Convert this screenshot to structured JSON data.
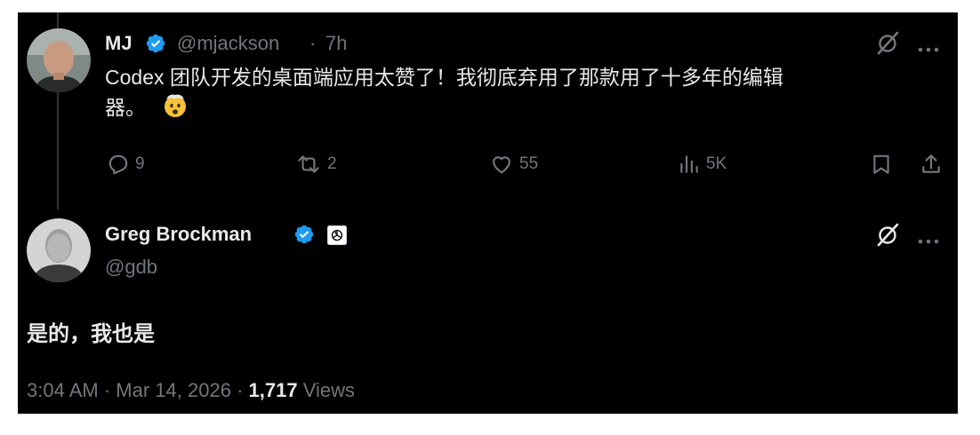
{
  "reply_context": {
    "display_name": "MJ",
    "handle": "@mjackson",
    "separator": "·",
    "time": "7h",
    "text_line1": "Codex 团队开发的桌面端应用太赞了！我彻底弃用了那款用了十多年的编辑",
    "text_line2": "器。",
    "emoji": "🤯",
    "actions": {
      "replies": "9",
      "reposts": "2",
      "likes": "55",
      "views": "5K"
    }
  },
  "main_tweet": {
    "display_name": "Greg Brockman",
    "handle": "@gdb",
    "text": "是的，我也是",
    "time": "3:04 AM",
    "date": "Mar 14, 2026",
    "separator": "·",
    "views_count": "1,717",
    "views_label": "Views"
  },
  "icons": {
    "verified": "verified-badge-icon",
    "affiliate": "openai-logo-icon",
    "grok": "grok-icon",
    "more": "more-icon",
    "reply": "reply-icon",
    "repost": "repost-icon",
    "like": "heart-icon",
    "views": "views-icon",
    "bookmark": "bookmark-icon",
    "share": "share-icon"
  },
  "colors": {
    "background": "#000000",
    "text_primary": "#e7e9ea",
    "text_secondary": "#71767b",
    "verified_blue": "#1d9bf0"
  }
}
